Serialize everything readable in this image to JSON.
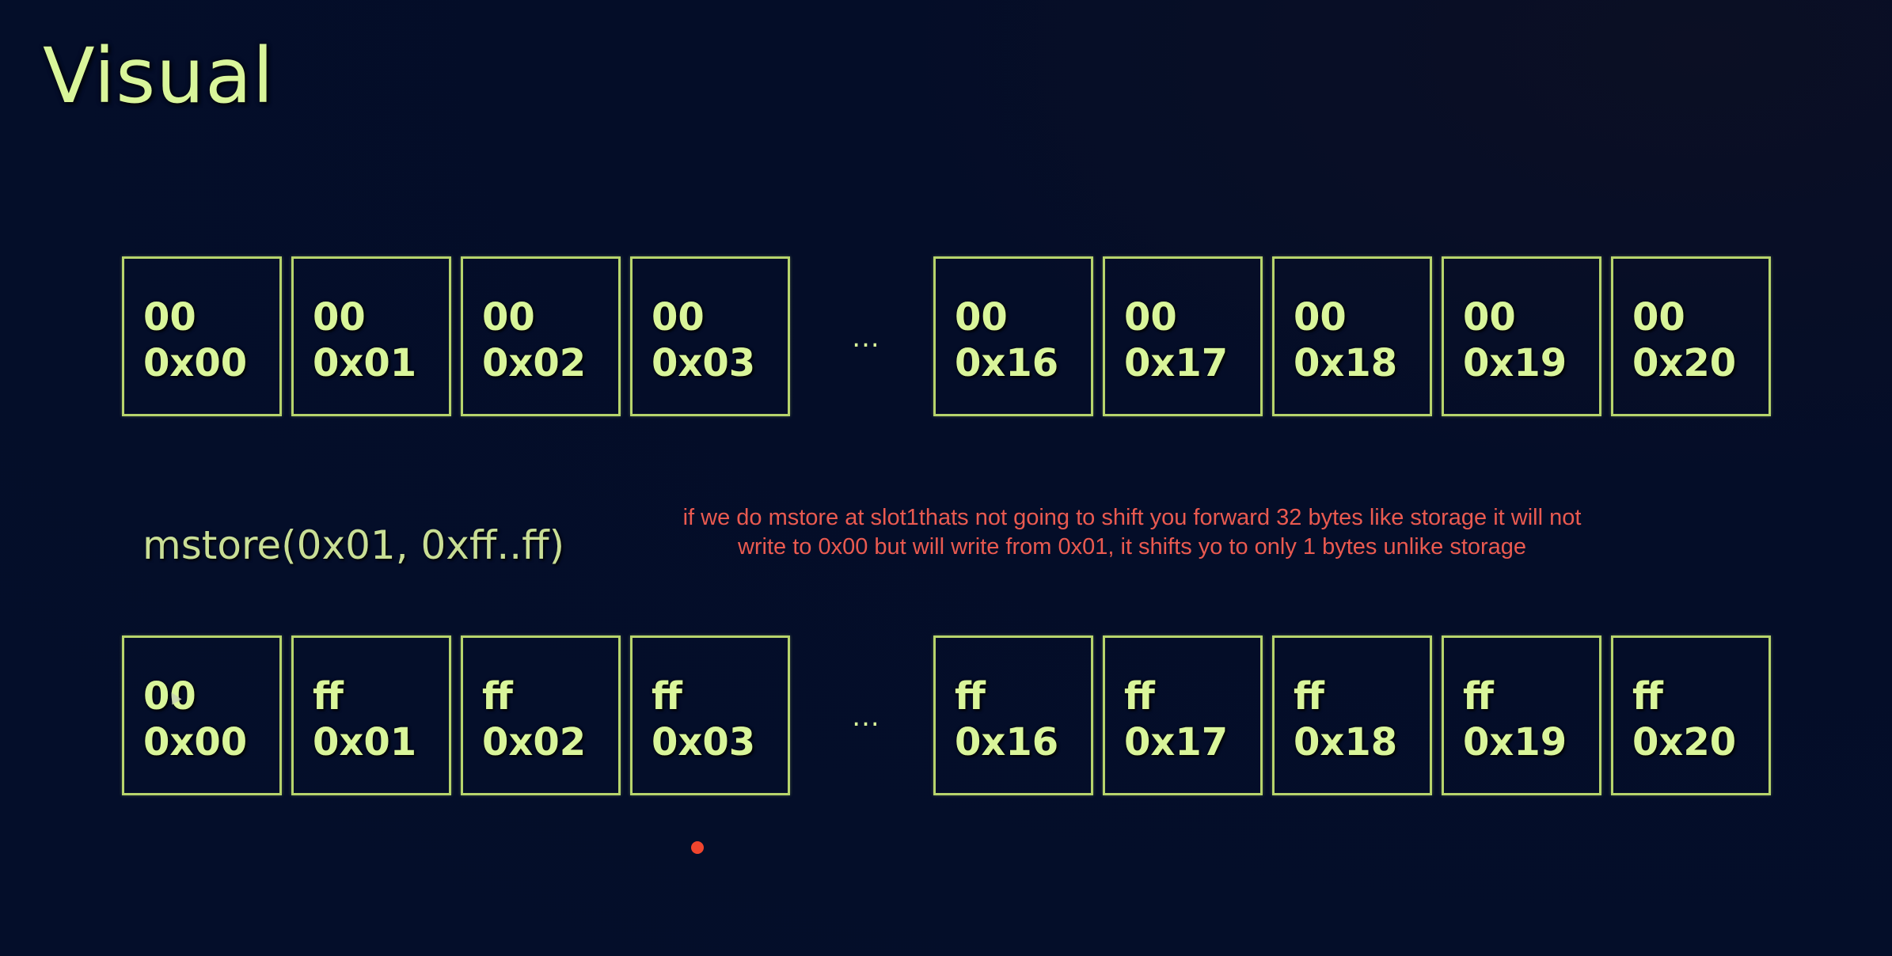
{
  "title": "Visual",
  "ellipsis": "...",
  "top_row": [
    {
      "value": "00",
      "address": "0x00"
    },
    {
      "value": "00",
      "address": "0x01"
    },
    {
      "value": "00",
      "address": "0x02"
    },
    {
      "value": "00",
      "address": "0x03"
    },
    {
      "value": "00",
      "address": "0x16"
    },
    {
      "value": "00",
      "address": "0x17"
    },
    {
      "value": "00",
      "address": "0x18"
    },
    {
      "value": "00",
      "address": "0x19"
    },
    {
      "value": "00",
      "address": "0x20"
    }
  ],
  "operation": "mstore(0x01, 0xff..ff)",
  "note": {
    "line1": "if we do mstore at slot1thats not going to shift you forward 32 bytes like storage it will not",
    "line2": "write to 0x00 but will write from 0x01, it shifts yo to only 1 bytes unlike storage"
  },
  "bottom_row": [
    {
      "value": "00",
      "address": "0x00"
    },
    {
      "value": "ff",
      "address": "0x01"
    },
    {
      "value": "ff",
      "address": "0x02"
    },
    {
      "value": "ff",
      "address": "0x03"
    },
    {
      "value": "ff",
      "address": "0x16"
    },
    {
      "value": "ff",
      "address": "0x17"
    },
    {
      "value": "ff",
      "address": "0x18"
    },
    {
      "value": "ff",
      "address": "0x19"
    },
    {
      "value": "ff",
      "address": "0x20"
    }
  ],
  "colors": {
    "background": "#040e2a",
    "cell_border": "#b7d46c",
    "cell_text": "#d9f59a",
    "note_text": "#ea5a50",
    "pointer_dot": "#f0452e"
  },
  "icons": {
    "pointer": "red-dot-icon",
    "cursor": "mouse-cursor-icon"
  }
}
